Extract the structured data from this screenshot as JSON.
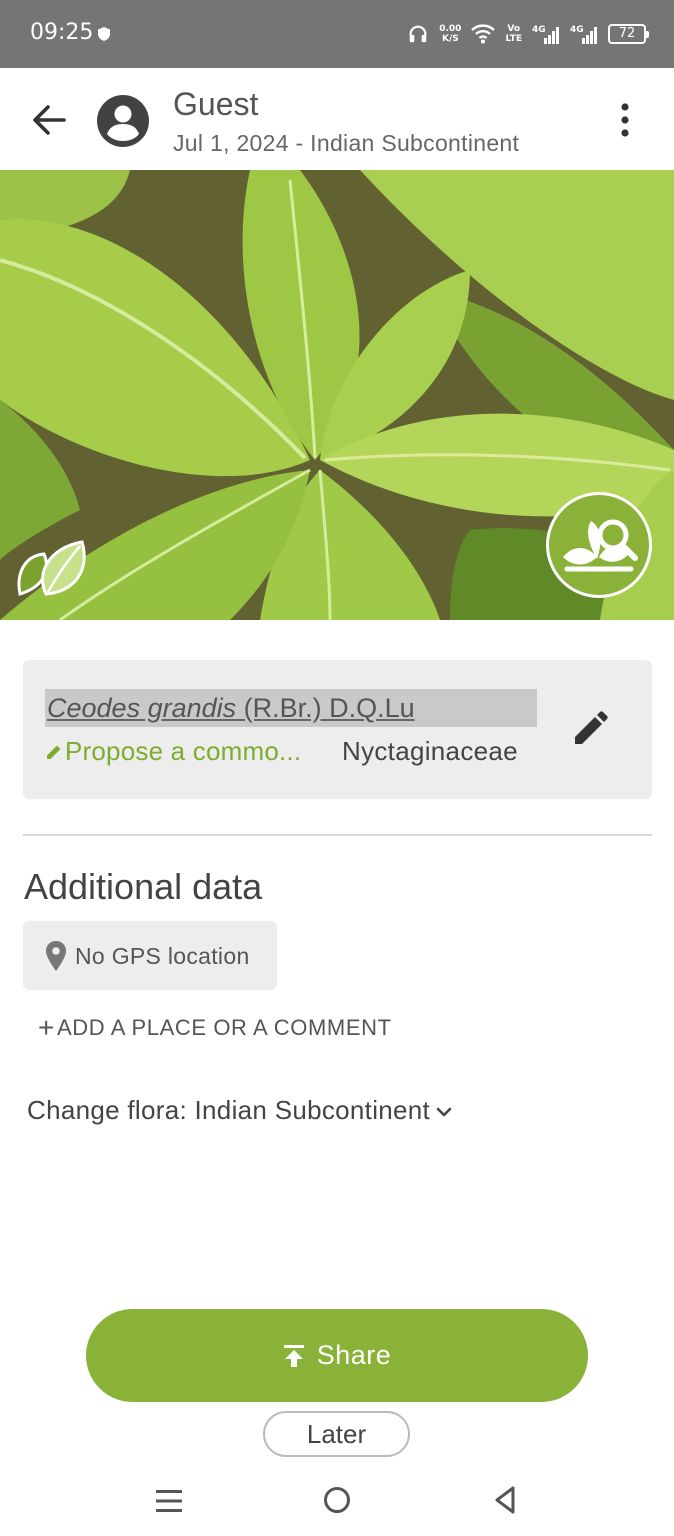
{
  "status_bar": {
    "time": "09:25",
    "net_speed_value": "0.00",
    "net_speed_unit": "K/S",
    "volte_top": "Vo",
    "volte_bottom": "LTE",
    "signal1_label": "4G",
    "signal2_label": "4G",
    "battery": "72",
    "icons": [
      "shield-icon",
      "headphones-icon",
      "wifi-icon",
      "signal-icon",
      "battery-icon"
    ]
  },
  "header": {
    "user_name": "Guest",
    "subtitle": "Jul 1, 2024 - Indian Subcontinent",
    "icons": [
      "back-arrow-icon",
      "account-circle-icon",
      "more-vert-icon"
    ]
  },
  "photo": {
    "icons": [
      "leaf-badge-icon",
      "plant-search-icon"
    ]
  },
  "species": {
    "genus_species": "Ceodes grandis",
    "author": " (R.Br.) D.Q.Lu",
    "propose_label": "Propose a commo...",
    "family": "Nyctaginaceae",
    "icons": [
      "pencil-icon",
      "edit-icon"
    ]
  },
  "additional": {
    "title": "Additional data",
    "gps_label": "No GPS location",
    "add_place_plus": "+",
    "add_place_label": "ADD A PLACE OR A COMMENT",
    "flora_label": "Change flora: Indian Subcontinent",
    "icons": [
      "location-pin-icon",
      "chevron-down-icon"
    ]
  },
  "actions": {
    "share_label": "Share",
    "later_label": "Later",
    "icons": [
      "upload-icon"
    ]
  },
  "nav": {
    "icons": [
      "menu-icon",
      "home-circle-icon",
      "back-triangle-icon"
    ]
  },
  "colors": {
    "accent": "#8bb238",
    "link_green": "#7cad2e",
    "status_bar": "#757575",
    "card_bg": "#ededed"
  }
}
